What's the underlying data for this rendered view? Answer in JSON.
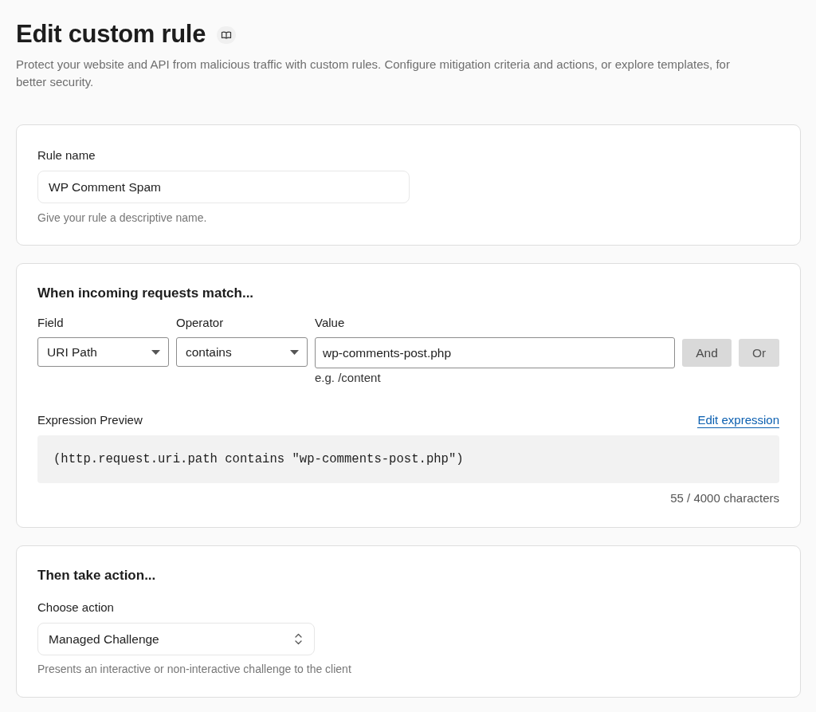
{
  "header": {
    "title": "Edit custom rule",
    "description": "Protect your website and API from malicious traffic with custom rules. Configure mitigation criteria and actions, or explore templates, for better security."
  },
  "rule_name": {
    "label": "Rule name",
    "value": "WP Comment Spam",
    "help": "Give your rule a descriptive name."
  },
  "match": {
    "heading": "When incoming requests match...",
    "conditions": [
      {
        "kind": "dropdown",
        "label": "Field",
        "value": "URI Path"
      },
      {
        "kind": "dropdown",
        "label": "Operator",
        "value": "contains"
      },
      {
        "kind": "text",
        "label": "Value",
        "value": "wp-comments-post.php",
        "hint": "e.g. /content"
      }
    ],
    "buttons": [
      "And",
      "Or"
    ],
    "preview": {
      "label": "Expression Preview",
      "link": "Edit expression",
      "expression": "(http.request.uri.path contains \"wp-comments-post.php\")",
      "count": "55 / 4000 characters"
    }
  },
  "action": {
    "heading": "Then take action...",
    "label": "Choose action",
    "value": "Managed Challenge",
    "help": "Presents an interactive or non-interactive challenge to the client"
  }
}
